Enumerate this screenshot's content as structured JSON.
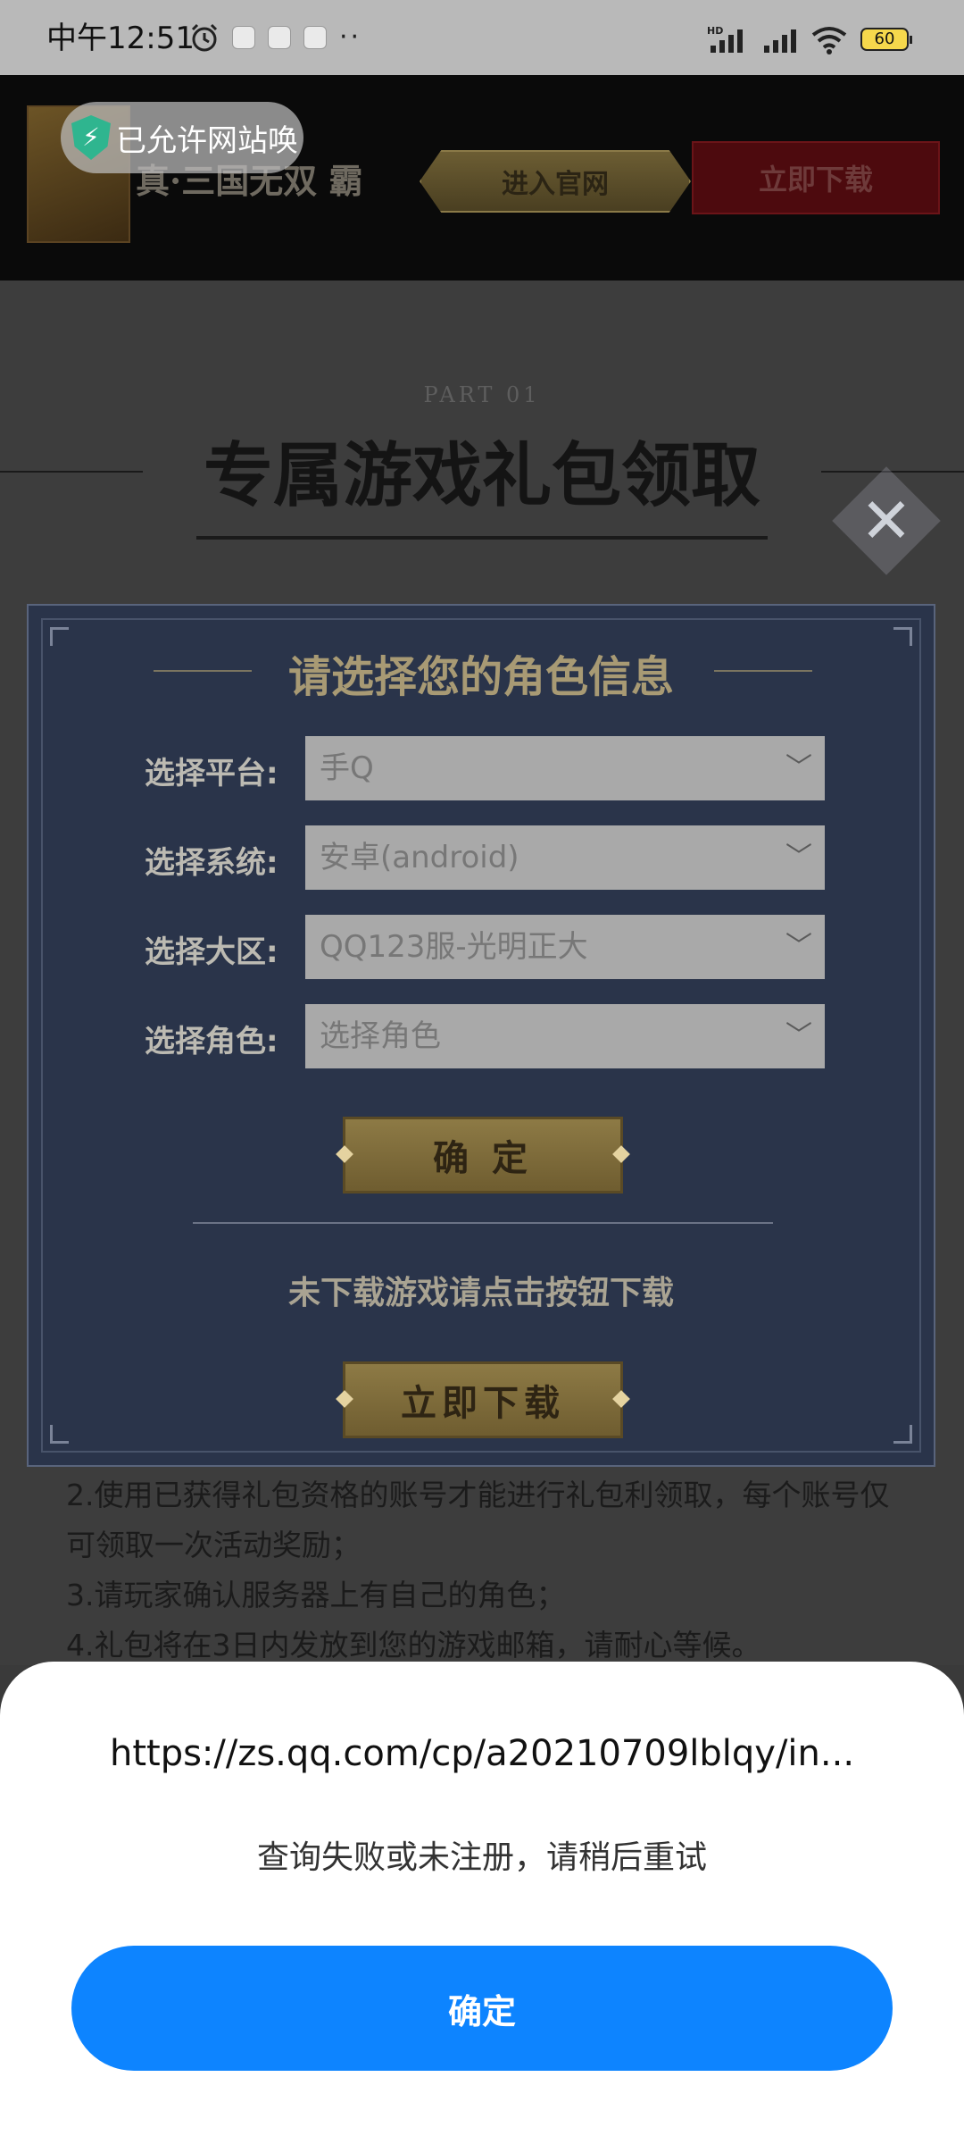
{
  "status_bar": {
    "time": "中午12:51",
    "dots": "··",
    "battery": "60"
  },
  "web_page": {
    "game_name": "真·三国无双 霸",
    "official_button": "进入官网",
    "download_top_button": "立即下载",
    "part_label": "PART 01",
    "section_title": "专属游戏礼包领取",
    "close_symbol": "✕"
  },
  "role_modal": {
    "title": "请选择您的角色信息",
    "fields": [
      {
        "label": "选择平台:",
        "value": "手Q"
      },
      {
        "label": "选择系统:",
        "value": "安卓(android)"
      },
      {
        "label": "选择大区:",
        "value": "QQ123服-光明正大"
      },
      {
        "label": "选择角色:",
        "value": "选择角色"
      }
    ],
    "confirm_button": "确 定",
    "download_hint": "未下载游戏请点击按钮下载",
    "download_button": "立即下载"
  },
  "notes": [
    "2.使用已获得礼包资格的账号才能进行礼包利领取，每个账号仅可领取一次活动奖励；",
    "3.请玩家确认服务器上有自己的角色；",
    "4.礼包将在3日内发放到您的游戏邮箱，请耐心等候。"
  ],
  "permission_toast": {
    "text": "已允许网站唤"
  },
  "dialog": {
    "url": "https://zs.qq.com/cp/a20210709lblqy/in...",
    "message": "查询失败或未注册，请稍后重试",
    "confirm_button": "确定"
  },
  "colors": {
    "accent": "#0d84ff",
    "modal_bg": "#2a344a",
    "gold": "#8d7a45"
  }
}
